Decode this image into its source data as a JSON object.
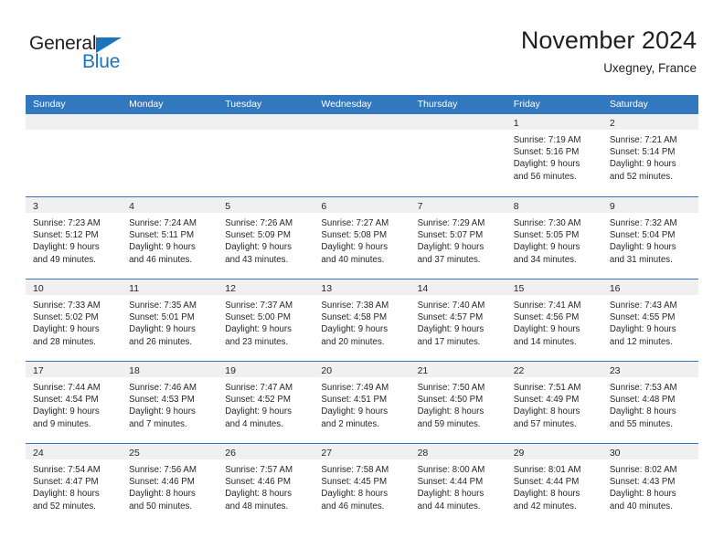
{
  "brand": {
    "name_part1": "General",
    "name_part2": "Blue",
    "triangle_color": "#1b75bb",
    "text_color": "#231f20"
  },
  "header": {
    "title": "November 2024",
    "subtitle": "Uxegney, France"
  },
  "colors": {
    "header_blue": "#3278be",
    "day_band_gray": "#f0f0f0",
    "text": "#262626",
    "accent_blue": "#1b75bb"
  },
  "weekdays": [
    "Sunday",
    "Monday",
    "Tuesday",
    "Wednesday",
    "Thursday",
    "Friday",
    "Saturday"
  ],
  "weeks": [
    [
      {
        "day": "",
        "empty": true
      },
      {
        "day": "",
        "empty": true
      },
      {
        "day": "",
        "empty": true
      },
      {
        "day": "",
        "empty": true
      },
      {
        "day": "",
        "empty": true
      },
      {
        "day": "1",
        "sunrise": "Sunrise: 7:19 AM",
        "sunset": "Sunset: 5:16 PM",
        "daylight1": "Daylight: 9 hours",
        "daylight2": "and 56 minutes."
      },
      {
        "day": "2",
        "sunrise": "Sunrise: 7:21 AM",
        "sunset": "Sunset: 5:14 PM",
        "daylight1": "Daylight: 9 hours",
        "daylight2": "and 52 minutes."
      }
    ],
    [
      {
        "day": "3",
        "sunrise": "Sunrise: 7:23 AM",
        "sunset": "Sunset: 5:12 PM",
        "daylight1": "Daylight: 9 hours",
        "daylight2": "and 49 minutes."
      },
      {
        "day": "4",
        "sunrise": "Sunrise: 7:24 AM",
        "sunset": "Sunset: 5:11 PM",
        "daylight1": "Daylight: 9 hours",
        "daylight2": "and 46 minutes."
      },
      {
        "day": "5",
        "sunrise": "Sunrise: 7:26 AM",
        "sunset": "Sunset: 5:09 PM",
        "daylight1": "Daylight: 9 hours",
        "daylight2": "and 43 minutes."
      },
      {
        "day": "6",
        "sunrise": "Sunrise: 7:27 AM",
        "sunset": "Sunset: 5:08 PM",
        "daylight1": "Daylight: 9 hours",
        "daylight2": "and 40 minutes."
      },
      {
        "day": "7",
        "sunrise": "Sunrise: 7:29 AM",
        "sunset": "Sunset: 5:07 PM",
        "daylight1": "Daylight: 9 hours",
        "daylight2": "and 37 minutes."
      },
      {
        "day": "8",
        "sunrise": "Sunrise: 7:30 AM",
        "sunset": "Sunset: 5:05 PM",
        "daylight1": "Daylight: 9 hours",
        "daylight2": "and 34 minutes."
      },
      {
        "day": "9",
        "sunrise": "Sunrise: 7:32 AM",
        "sunset": "Sunset: 5:04 PM",
        "daylight1": "Daylight: 9 hours",
        "daylight2": "and 31 minutes."
      }
    ],
    [
      {
        "day": "10",
        "sunrise": "Sunrise: 7:33 AM",
        "sunset": "Sunset: 5:02 PM",
        "daylight1": "Daylight: 9 hours",
        "daylight2": "and 28 minutes."
      },
      {
        "day": "11",
        "sunrise": "Sunrise: 7:35 AM",
        "sunset": "Sunset: 5:01 PM",
        "daylight1": "Daylight: 9 hours",
        "daylight2": "and 26 minutes."
      },
      {
        "day": "12",
        "sunrise": "Sunrise: 7:37 AM",
        "sunset": "Sunset: 5:00 PM",
        "daylight1": "Daylight: 9 hours",
        "daylight2": "and 23 minutes."
      },
      {
        "day": "13",
        "sunrise": "Sunrise: 7:38 AM",
        "sunset": "Sunset: 4:58 PM",
        "daylight1": "Daylight: 9 hours",
        "daylight2": "and 20 minutes."
      },
      {
        "day": "14",
        "sunrise": "Sunrise: 7:40 AM",
        "sunset": "Sunset: 4:57 PM",
        "daylight1": "Daylight: 9 hours",
        "daylight2": "and 17 minutes."
      },
      {
        "day": "15",
        "sunrise": "Sunrise: 7:41 AM",
        "sunset": "Sunset: 4:56 PM",
        "daylight1": "Daylight: 9 hours",
        "daylight2": "and 14 minutes."
      },
      {
        "day": "16",
        "sunrise": "Sunrise: 7:43 AM",
        "sunset": "Sunset: 4:55 PM",
        "daylight1": "Daylight: 9 hours",
        "daylight2": "and 12 minutes."
      }
    ],
    [
      {
        "day": "17",
        "sunrise": "Sunrise: 7:44 AM",
        "sunset": "Sunset: 4:54 PM",
        "daylight1": "Daylight: 9 hours",
        "daylight2": "and 9 minutes."
      },
      {
        "day": "18",
        "sunrise": "Sunrise: 7:46 AM",
        "sunset": "Sunset: 4:53 PM",
        "daylight1": "Daylight: 9 hours",
        "daylight2": "and 7 minutes."
      },
      {
        "day": "19",
        "sunrise": "Sunrise: 7:47 AM",
        "sunset": "Sunset: 4:52 PM",
        "daylight1": "Daylight: 9 hours",
        "daylight2": "and 4 minutes."
      },
      {
        "day": "20",
        "sunrise": "Sunrise: 7:49 AM",
        "sunset": "Sunset: 4:51 PM",
        "daylight1": "Daylight: 9 hours",
        "daylight2": "and 2 minutes."
      },
      {
        "day": "21",
        "sunrise": "Sunrise: 7:50 AM",
        "sunset": "Sunset: 4:50 PM",
        "daylight1": "Daylight: 8 hours",
        "daylight2": "and 59 minutes."
      },
      {
        "day": "22",
        "sunrise": "Sunrise: 7:51 AM",
        "sunset": "Sunset: 4:49 PM",
        "daylight1": "Daylight: 8 hours",
        "daylight2": "and 57 minutes."
      },
      {
        "day": "23",
        "sunrise": "Sunrise: 7:53 AM",
        "sunset": "Sunset: 4:48 PM",
        "daylight1": "Daylight: 8 hours",
        "daylight2": "and 55 minutes."
      }
    ],
    [
      {
        "day": "24",
        "sunrise": "Sunrise: 7:54 AM",
        "sunset": "Sunset: 4:47 PM",
        "daylight1": "Daylight: 8 hours",
        "daylight2": "and 52 minutes."
      },
      {
        "day": "25",
        "sunrise": "Sunrise: 7:56 AM",
        "sunset": "Sunset: 4:46 PM",
        "daylight1": "Daylight: 8 hours",
        "daylight2": "and 50 minutes."
      },
      {
        "day": "26",
        "sunrise": "Sunrise: 7:57 AM",
        "sunset": "Sunset: 4:46 PM",
        "daylight1": "Daylight: 8 hours",
        "daylight2": "and 48 minutes."
      },
      {
        "day": "27",
        "sunrise": "Sunrise: 7:58 AM",
        "sunset": "Sunset: 4:45 PM",
        "daylight1": "Daylight: 8 hours",
        "daylight2": "and 46 minutes."
      },
      {
        "day": "28",
        "sunrise": "Sunrise: 8:00 AM",
        "sunset": "Sunset: 4:44 PM",
        "daylight1": "Daylight: 8 hours",
        "daylight2": "and 44 minutes."
      },
      {
        "day": "29",
        "sunrise": "Sunrise: 8:01 AM",
        "sunset": "Sunset: 4:44 PM",
        "daylight1": "Daylight: 8 hours",
        "daylight2": "and 42 minutes."
      },
      {
        "day": "30",
        "sunrise": "Sunrise: 8:02 AM",
        "sunset": "Sunset: 4:43 PM",
        "daylight1": "Daylight: 8 hours",
        "daylight2": "and 40 minutes."
      }
    ]
  ]
}
